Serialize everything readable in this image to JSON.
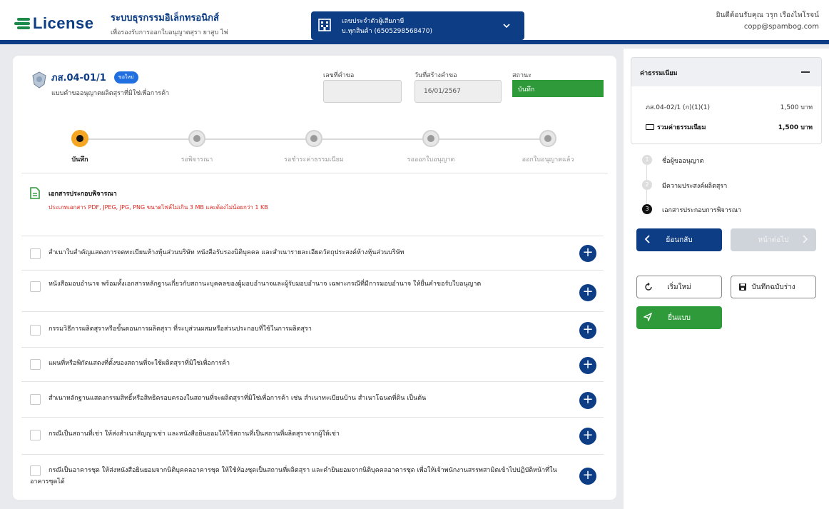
{
  "header": {
    "logo_text": "License",
    "system_title": "ระบบธุรกรรมอิเล็กทรอนิกส์",
    "system_subtitle": "เพื่อรองรับการออกใบอนุญาตสุรา ยาสูบ ไพ่",
    "taxpayer_label": "เลขประจำตัวผู้เสียภาษี",
    "taxpayer_value": "บ.ทุกสินค้า (6505298568470)",
    "welcome": "ยินดีต้อนรับคุณ วรุก เรืองไพโรจน์",
    "email": "copp@spambog.com"
  },
  "form": {
    "code": "ภส.04-01/1",
    "badge": "ขอใหม่",
    "description": "แบบคำขออนุญาตผลิตสุราที่มิใช่เพื่อการค้า",
    "request_no_label": "เลขที่คำขอ",
    "request_no_value": "",
    "created_date_label": "วันที่สร้างคำขอ",
    "created_date_value": "16/01/2567",
    "status_label": "สถานะ",
    "status_value": "บันทึก"
  },
  "steps": [
    {
      "label": "บันทึก"
    },
    {
      "label": "รอพิจารณา"
    },
    {
      "label": "รอชำระค่าธรรมเนียม"
    },
    {
      "label": "รอออกใบอนุญาต"
    },
    {
      "label": "ออกใบอนุญาตแล้ว"
    }
  ],
  "documents": {
    "title": "เอกสารประกอบพิจารณา",
    "note": "ประเภทเอกสาร PDF, JPEG, JPG, PNG ขนาดไฟล์ไม่เกิน 3 MB และต้องไม่น้อยกว่า 1 KB",
    "items": [
      "สำเนาใบสำคัญแสดงการจดทะเบียนห้างหุ้นส่วนบริษัท หนังสือรับรองนิติบุคคล และสำเนารายละเอียดวัตถุประสงค์ห้างหุ้นส่วนบริษัท",
      "หนังสือมอบอำนาจ พร้อมทั้งเอกสารหลักฐานเกี่ยวกับสถานะบุคคลของผู้มอบอำนาจและผู้รับมอบอำนาจ เฉพาะกรณีที่มีการมอบอำนาจ ให้ยื่นคำขอรับใบอนุญาต",
      "กรรมวิธีการผลิตสุราหรือขั้นตอนการผลิตสุรา ที่ระบุส่วนผสมหรือส่วนประกอบที่ใช้ในการผลิตสุรา",
      "แผนที่หรือพิกัดแสดงที่ตั้งของสถานที่จะใช้ผลิตสุราที่มิใช่เพื่อการค้า",
      "สำเนาหลักฐานแสดงกรรมสิทธิ์หรือสิทธิครอบครองในสถานที่จะผลิตสุราที่มิใช่เพื่อการค้า เช่น สำเนาทะเบียนบ้าน สำเนาโฉนดที่ดิน เป็นต้น",
      "กรณีเป็นสถานที่เช่า ให้ส่งสำเนาสัญญาเช่า และหนังสือยินยอมให้ใช้สถานที่เป็นสถานที่ผลิตสุราจากผู้ให้เช่า",
      "กรณีเป็นอาคารชุด ให้ส่งหนังสือยินยอมจากนิติบุคคลอาคารชุด ให้ใช้ห้องชุดเป็นสถานที่ผลิตสุรา และคำยินยอมจากนิติบุคคลอาคารชุด เพื่อให้เจ้าพนักงานสรรพสามิตเข้าไปปฏิบัติหน้าที่ในอาคารชุดได้"
    ]
  },
  "fees": {
    "title": "ค่าธรรมเนียม",
    "line_label": "ภส.04-02/1 (ก)(1)(1)",
    "line_value": "1,500 บาท",
    "total_label": "รวมค่าธรรมเนียม",
    "total_value": "1,500 บาท"
  },
  "menu": [
    {
      "num": "1",
      "label": "ชื่อผู้ขออนุญาต"
    },
    {
      "num": "2",
      "label": "มีความประสงค์ผลิตสุรา"
    },
    {
      "num": "3",
      "label": "เอกสารประกอบการพิจารณา"
    }
  ],
  "buttons": {
    "back": "ย้อนกลับ",
    "next": "หน้าต่อไป",
    "reset": "เริ่มใหม่",
    "draft": "บันทึกฉบับร่าง",
    "submit": "ยื่นแบบ"
  },
  "colors": {
    "primary": "#0d3d85",
    "success": "#2f9a3a",
    "warning_step": "#f5a623",
    "error_text": "#e2231a"
  }
}
